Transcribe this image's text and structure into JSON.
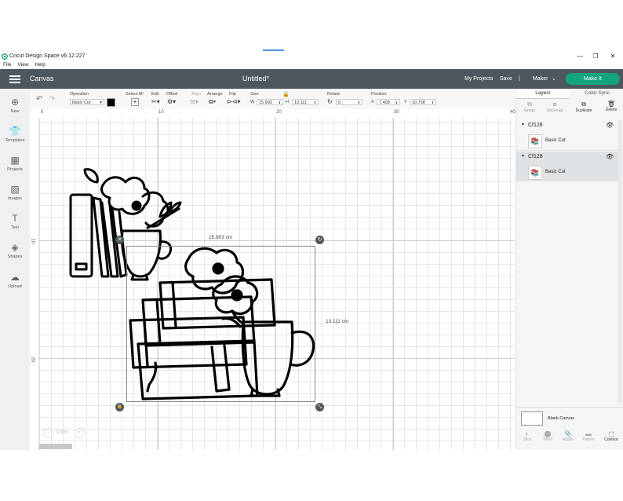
{
  "window": {
    "title": "Cricut Design Space  v6.12.227",
    "controls": [
      "—",
      "❐",
      "✕"
    ]
  },
  "menu": [
    "File",
    "View",
    "Help"
  ],
  "header": {
    "section": "Canvas",
    "doc_title": "Untitled*",
    "my_projects": "My Projects",
    "save": "Save",
    "separator": "|",
    "machine": "Maker",
    "make_it": "Make It"
  },
  "toolbar": {
    "undo_icon": "undo-icon",
    "redo_icon": "redo-icon",
    "operation_label": "Operation",
    "operation_value": "Basic Cut",
    "color_hex": "#000000",
    "select_all": "Select All",
    "edit": "Edit",
    "offset": "Offset",
    "align": "Align",
    "arrange": "Arrange",
    "flip": "Flip",
    "size_label": "Size",
    "w_label": "W",
    "w_value": "15.903",
    "h_label": "H",
    "h_value": "13.111",
    "rotate_label": "Rotate",
    "rotate_value": "0",
    "position_label": "Position",
    "x_label": "X",
    "x_value": "7.408",
    "y_label": "Y",
    "y_value": "10.758"
  },
  "sidebar": {
    "items": [
      {
        "label": "New",
        "icon": "plus-circle-icon",
        "glyph": "⊕"
      },
      {
        "label": "Templates",
        "icon": "shirt-icon",
        "glyph": "👕"
      },
      {
        "label": "Projects",
        "icon": "projects-icon",
        "glyph": "▦"
      },
      {
        "label": "Images",
        "icon": "image-icon",
        "glyph": "▨"
      },
      {
        "label": "Text",
        "icon": "text-icon",
        "glyph": "T"
      },
      {
        "label": "Shapes",
        "icon": "shapes-icon",
        "glyph": "◈"
      },
      {
        "label": "Upload",
        "icon": "upload-icon",
        "glyph": "☁"
      }
    ]
  },
  "rulers": {
    "top": [
      "0",
      "10",
      "20",
      "30",
      "40"
    ],
    "left": [
      "10",
      "20"
    ]
  },
  "canvas": {
    "width_dim": "15.903 cm",
    "height_dim": "13.111 cm",
    "zoom": "100%",
    "zoom_minus": "−",
    "zoom_plus": "+"
  },
  "panel": {
    "tabs": [
      "Layers",
      "Color Sync"
    ],
    "actions": [
      {
        "label": "Group",
        "enabled": false
      },
      {
        "label": "UnGroup",
        "enabled": false
      },
      {
        "label": "Duplicate",
        "enabled": true
      },
      {
        "label": "Delete",
        "enabled": true
      }
    ],
    "layers": [
      {
        "name": "Cf128",
        "sub": "Basic Cut",
        "selected": false
      },
      {
        "name": "Cf128",
        "sub": "Basic Cut",
        "selected": true
      }
    ],
    "blank_canvas": "Blank Canvas",
    "bottom_actions": [
      {
        "label": "Slice",
        "enabled": false
      },
      {
        "label": "Weld",
        "enabled": false
      },
      {
        "label": "Attach",
        "enabled": false
      },
      {
        "label": "Flatten",
        "enabled": false
      },
      {
        "label": "Contour",
        "enabled": true
      }
    ]
  },
  "colors": {
    "header_bg": "#4e575d",
    "make_it": "#14a37f",
    "selected_layer": "#dfe2e4"
  }
}
